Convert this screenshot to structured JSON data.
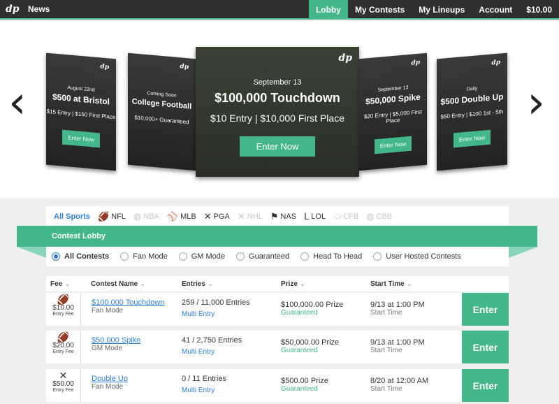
{
  "nav": {
    "logo": "dp",
    "news": "News",
    "items": [
      {
        "label": "Lobby",
        "active": true
      },
      {
        "label": "My Contests",
        "active": false
      },
      {
        "label": "My Lineups",
        "active": false
      },
      {
        "label": "Account",
        "active": false
      },
      {
        "label": "$10.00",
        "active": false
      }
    ]
  },
  "carousel": {
    "prev_icon": "chevron-left-icon",
    "next_icon": "chevron-right-icon",
    "cards": [
      {
        "date": "August 22nd",
        "title": "$500 at Bristol",
        "sub": "$15 Entry | $150 First Place",
        "button": "Enter Now"
      },
      {
        "date": "Coming Soon",
        "title": "College Football",
        "sub": "$10,000+ Guaranteed",
        "button": "Enter Now"
      },
      {
        "date": "September 13",
        "title": "$100,000 Touchdown",
        "sub": "$10 Entry | $10,000 First Place",
        "button": "Enter Now"
      },
      {
        "date": "September 13",
        "title": "$50,000 Spike",
        "sub": "$20 Entry | $5,000 First Place",
        "button": "Enter Now"
      },
      {
        "date": "Daily",
        "title": "$500 Double Up",
        "sub": "$50 Entry | $100 1st - 5th",
        "button": "Enter Now"
      }
    ]
  },
  "sports": [
    {
      "label": "All Sports",
      "icon": "",
      "state": "active"
    },
    {
      "label": "NFL",
      "icon": "football-icon",
      "state": "normal"
    },
    {
      "label": "NBA",
      "icon": "basketball-icon",
      "state": "disabled"
    },
    {
      "label": "MLB",
      "icon": "baseball-icon",
      "state": "normal"
    },
    {
      "label": "PGA",
      "icon": "golf-clubs-icon",
      "state": "normal"
    },
    {
      "label": "NHL",
      "icon": "hockey-sticks-icon",
      "state": "disabled"
    },
    {
      "label": "NAS",
      "icon": "checkered-flag-icon",
      "state": "normal"
    },
    {
      "label": "LOL",
      "icon": "lol-icon",
      "state": "normal"
    },
    {
      "label": "CFB",
      "icon": "football-icon",
      "state": "disabled"
    },
    {
      "label": "CBB",
      "icon": "basketball-icon",
      "state": "disabled"
    }
  ],
  "lobby": {
    "title": "Contest Lobby"
  },
  "filters": [
    {
      "label": "All Contests",
      "selected": true
    },
    {
      "label": "Fan Mode",
      "selected": false
    },
    {
      "label": "GM Mode",
      "selected": false
    },
    {
      "label": "Guaranteed",
      "selected": false
    },
    {
      "label": "Head To Head",
      "selected": false
    },
    {
      "label": "User Hosted Contests",
      "selected": false
    }
  ],
  "table": {
    "headers": {
      "fee": "Fee",
      "name": "Contest Name",
      "entries": "Entries",
      "prize": "Prize",
      "start": "Start Time"
    },
    "rows": [
      {
        "icon": "football-icon",
        "fee": "$10.00",
        "fee_label": "Entry Fee",
        "name": "$100,000 Touchdown",
        "mode": "Fan Mode",
        "entries": "259 / 11,000 Entries",
        "multi": "Multi Entry",
        "prize": "$100,000.00 Prize",
        "prize_note": "Guaranteed",
        "start": "9/13 at 1:00 PM",
        "start_label": "Start Time",
        "enter": "Enter"
      },
      {
        "icon": "football-icon",
        "fee": "$20.00",
        "fee_label": "Entry Fee",
        "name": "$50,000 Spike",
        "mode": "GM Mode",
        "entries": "41 / 2,750 Entries",
        "multi": "Multi Entry",
        "prize": "$50,000.00 Prize",
        "prize_note": "Guaranteed",
        "start": "9/13 at 1:00 PM",
        "start_label": "Start Time",
        "enter": "Enter"
      },
      {
        "icon": "golf-clubs-icon",
        "fee": "$50.00",
        "fee_label": "Entry Fee",
        "name": "Double Up",
        "mode": "Fan Mode",
        "entries": "0 / 11 Entries",
        "multi": "Multi Entry",
        "prize": "$500.00 Prize",
        "prize_note": "Guaranteed",
        "start": "8/20 at 12:00 AM",
        "start_label": "Start Time",
        "enter": "Enter"
      }
    ]
  },
  "colors": {
    "accent": "#43b68a",
    "nav_bg": "#2f2f2f",
    "link": "#2e7fd6"
  }
}
